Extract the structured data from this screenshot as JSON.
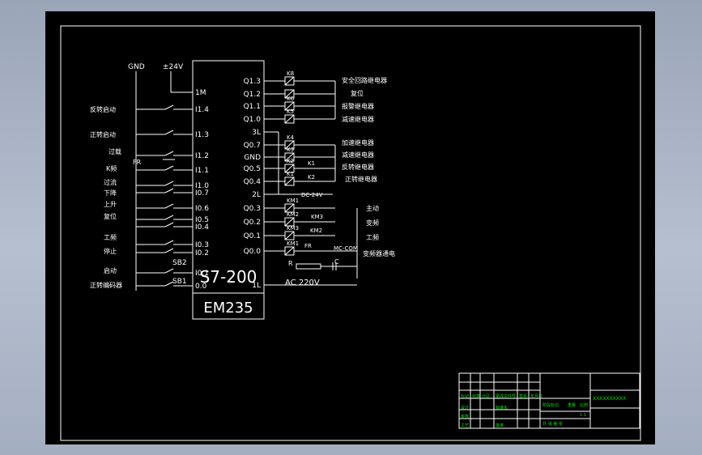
{
  "drawing": {
    "plc_model": "S7-200",
    "module_name": "EM235",
    "power": {
      "gnd": "GND",
      "v24": "±24V"
    },
    "inputs": [
      {
        "terminal": "1M",
        "label": ""
      },
      {
        "terminal": "I1.4",
        "label": "反转启动"
      },
      {
        "terminal": "I1.3",
        "label": "正转启动"
      },
      {
        "terminal": "I1.2",
        "label": "过载"
      },
      {
        "terminal": "I1.1",
        "label": "K频"
      },
      {
        "terminal": "I1.0",
        "label": "过流"
      },
      {
        "terminal": "I0.7",
        "label": "下降"
      },
      {
        "terminal": "I0.6",
        "label": "上升"
      },
      {
        "terminal": "I0.5",
        "label": "复位"
      },
      {
        "terminal": "I0.4",
        "label": ""
      },
      {
        "terminal": "I0.3",
        "label": "工频"
      },
      {
        "terminal": "I0.2",
        "label": "停止"
      },
      {
        "terminal": "I0.1",
        "label": "启动"
      },
      {
        "terminal": "0.0",
        "label": "正转编码器"
      }
    ],
    "outputs": [
      {
        "terminal": "Q1.3",
        "coil": "K8",
        "label": "安全回路继电器"
      },
      {
        "terminal": "Q1.2",
        "coil": "",
        "label": "复位"
      },
      {
        "terminal": "Q1.1",
        "coil": "K6",
        "label": "报警继电器"
      },
      {
        "terminal": "Q1.0",
        "coil": "K5",
        "label": "减速继电器"
      },
      {
        "terminal": "3L",
        "coil": "",
        "label": ""
      },
      {
        "terminal": "Q0.7",
        "coil": "K4",
        "label": "加速继电器"
      },
      {
        "terminal": "GND",
        "coil": "K3",
        "label": "减速继电器"
      },
      {
        "terminal": "Q0.5",
        "coil": "K2",
        "label": "反转继电器"
      },
      {
        "terminal": "Q0.4",
        "coil": "K1",
        "label": "正转继电器"
      },
      {
        "terminal": "2L",
        "coil": "",
        "label": ""
      },
      {
        "terminal": "Q0.3",
        "coil": "KM1",
        "label": "主动"
      },
      {
        "terminal": "Q0.2",
        "coil": "KM2",
        "label": "变频"
      },
      {
        "terminal": "Q0.1",
        "coil": "KM3",
        "label": "工频"
      },
      {
        "terminal": "Q0.0",
        "coil": "KM1",
        "label": "变频器通电"
      },
      {
        "terminal": "1L",
        "coil": "",
        "label": ""
      }
    ],
    "contacts": {
      "k1": "K1",
      "k2": "K2",
      "km2": "KM2",
      "km3": "KM3",
      "fr_in": "FR",
      "fr_out": "FR"
    },
    "switches": {
      "sb1": "SB1",
      "sb2": "SB2"
    },
    "dc_label": "DC-24V",
    "mc_com": "MC-COM",
    "resistor": "R",
    "capacitor": "C",
    "ac_label": "AC  220V"
  },
  "title_block": {
    "rows": [
      [
        "标记",
        "处数",
        "分区",
        "更改文件号",
        "签名",
        "年月日"
      ],
      [
        "设计",
        "",
        "",
        "标准化",
        "",
        ""
      ],
      [
        "审核",
        "",
        "",
        "",
        "",
        ""
      ],
      [
        "工艺",
        "",
        "",
        "批准",
        "",
        ""
      ]
    ],
    "stage": "阶段标记",
    "weight": "重量",
    "scale": "比例",
    "scale_value": "1:1",
    "sheets": "共  张  第  张",
    "drawing_name": "XXXXXXXXXX"
  }
}
